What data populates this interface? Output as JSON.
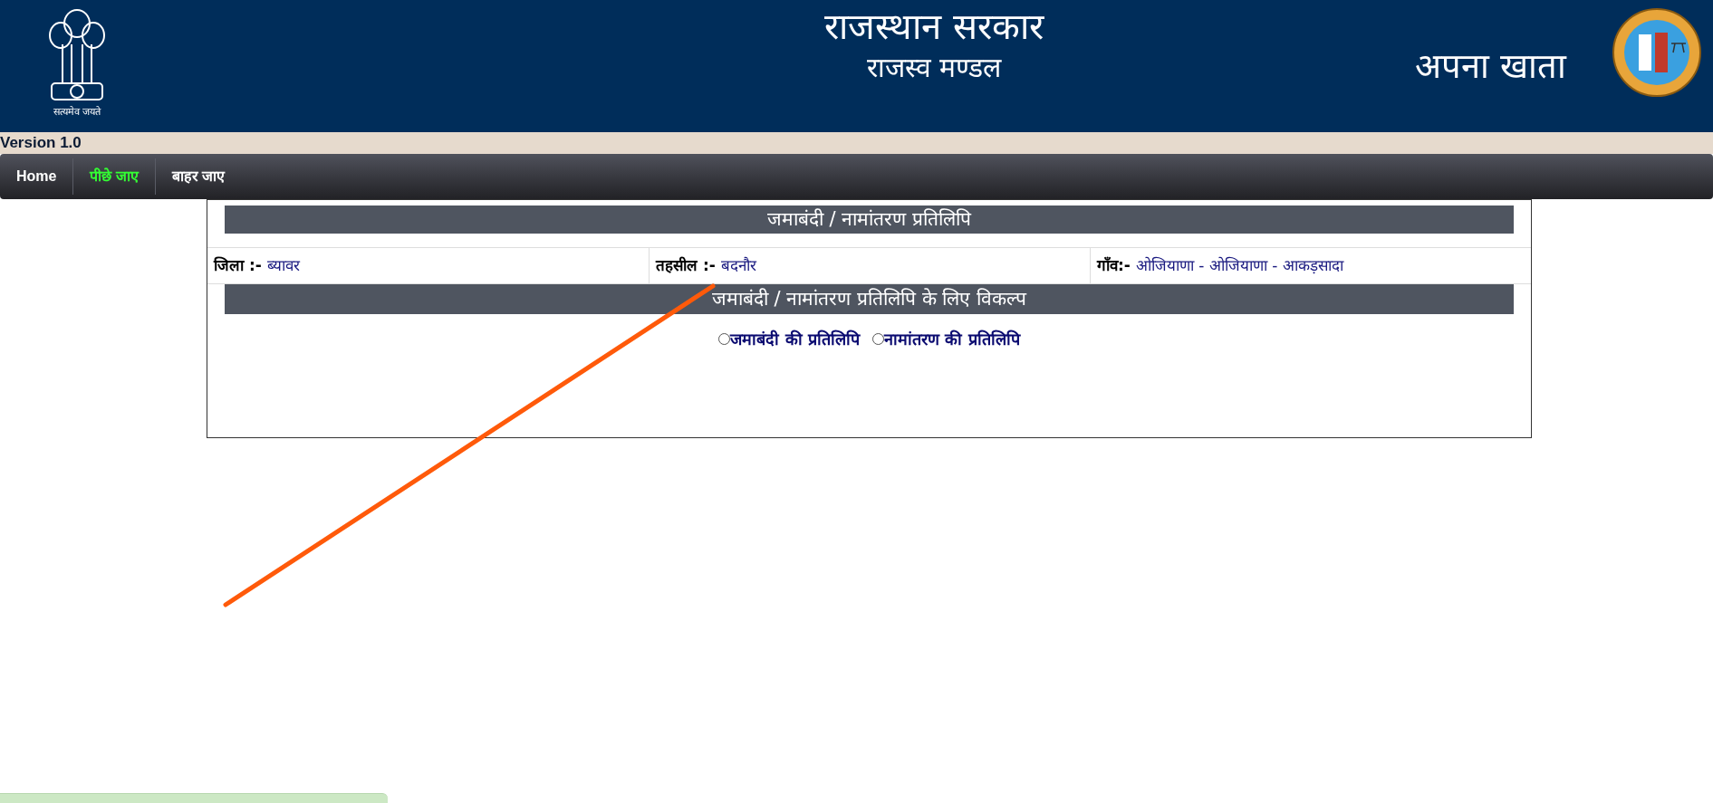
{
  "header": {
    "emblem_caption": "सत्यमेव जयते",
    "title": "राजस्थान सरकार",
    "subtitle": "राजस्व मण्डल",
    "app_name": "अपना खाता"
  },
  "version": "Version 1.0",
  "nav": [
    {
      "label": "Home",
      "color": "#ffffff"
    },
    {
      "label": "पीछे जाए",
      "color": "#33ff33"
    },
    {
      "label": "बाहर जाए",
      "color": "#ffffff"
    }
  ],
  "panel": {
    "heading": "जमाबंदी / नामांतरण प्रतिलिपि",
    "fields": [
      {
        "label": "जिला :-",
        "value": "ब्यावर"
      },
      {
        "label": "तहसील :-",
        "value": "बदनौर"
      },
      {
        "label": "गाँव:-",
        "value": "ओजियाणा - ओजियाणा - आकड़सादा"
      }
    ],
    "options_heading": "जमाबंदी / नामांतरण प्रतिलिपि के लिए विकल्प",
    "options": [
      {
        "label": "जमाबंदी की प्रतिलिपि",
        "selected": false
      },
      {
        "label": "नामांतरण की प्रतिलिपि",
        "selected": false
      }
    ]
  }
}
